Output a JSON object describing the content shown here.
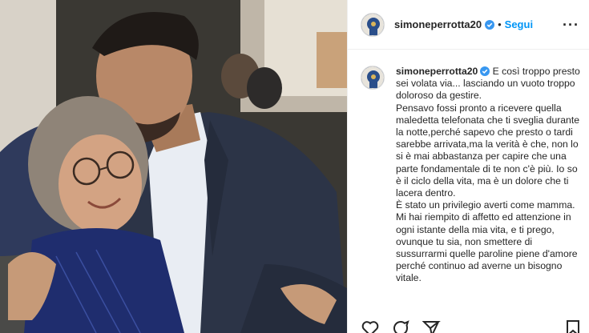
{
  "post": {
    "username": "simoneperrotta20",
    "verified_icon": "verified-badge-icon",
    "separator": "•",
    "follow_label": "Segui",
    "more_label": "···",
    "caption_text": " E così troppo presto sei volata via... lasciando un vuoto troppo doloroso da gestire.\nPensavo fossi pronto a ricevere quella maledetta telefonata che ti sveglia durante la notte,perché sapevo che presto o tardi sarebbe arrivata,ma la verità è che, non lo si è mai abbastanza per capire che una parte fondamentale di te non c'è più. Io so è il ciclo della vita, ma è un dolore che ti lacera dentro.\nÈ stato un privilegio averti come mamma. Mi hai riempito di affetto ed attenzione in ogni istante della mia vita, e ti prego, ovunque tu sia, non smettere di sussurrarmi quelle paroline piene d'amore perché continuo ad averne un bisogno vitale."
  },
  "colors": {
    "link_blue": "#0095f6",
    "verified_blue": "#3897f0",
    "text": "#262626",
    "border": "#efefef"
  },
  "icons": {
    "like": "heart-icon",
    "comment": "comment-icon",
    "share": "share-icon",
    "save": "bookmark-icon"
  }
}
